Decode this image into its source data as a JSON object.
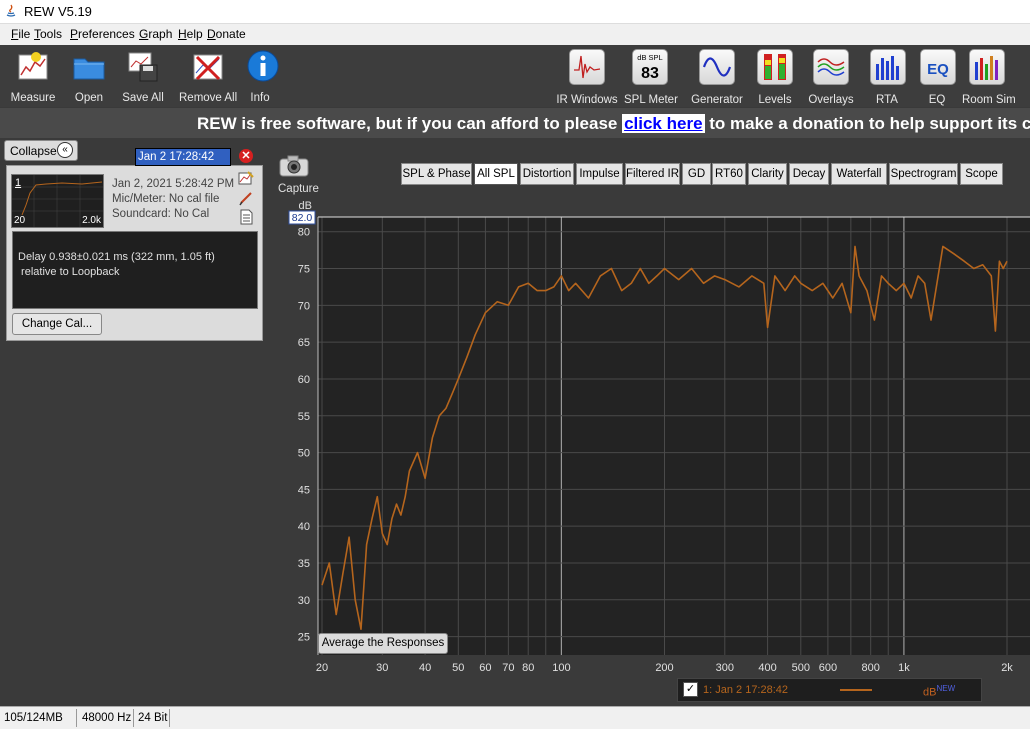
{
  "window": {
    "title": "REW V5.19"
  },
  "menu": [
    "File",
    "Tools",
    "Preferences",
    "Graph",
    "Help",
    "Donate"
  ],
  "toolbar_left": [
    {
      "label": "Measure",
      "icon": "measure-icon"
    },
    {
      "label": "Open",
      "icon": "folder-icon"
    },
    {
      "label": "Save All",
      "icon": "save-all-icon"
    },
    {
      "label": "Remove All",
      "icon": "remove-all-icon"
    },
    {
      "label": "Info",
      "icon": "info-icon"
    }
  ],
  "toolbar_right": [
    {
      "label": "IR Windows",
      "icon": "ir-windows-icon"
    },
    {
      "label": "SPL Meter",
      "icon": "spl-meter-icon",
      "display_top": "dB SPL",
      "display_value": "83"
    },
    {
      "label": "Generator",
      "icon": "generator-icon"
    },
    {
      "label": "Levels",
      "icon": "levels-icon"
    },
    {
      "label": "Overlays",
      "icon": "overlays-icon"
    },
    {
      "label": "RTA",
      "icon": "rta-icon"
    },
    {
      "label": "EQ",
      "icon": "eq-icon",
      "text": "EQ"
    },
    {
      "label": "Room Sim",
      "icon": "room-sim-icon"
    }
  ],
  "banner": {
    "pre": "REW is free software, but if you can afford to please ",
    "link": "click here",
    "post": " to make a donation to help support its continuin"
  },
  "measurement_panel": {
    "collapse_label": "Collapse",
    "name_field": "Jan 2 17:28:42",
    "thumb_index": "1",
    "thumb_xmin": "20",
    "thumb_xmax": "2.0k",
    "date": "Jan 2, 2021 5:28:42 PM",
    "mic": "Mic/Meter: No cal file",
    "soundcard": "Soundcard: No Cal",
    "delay_line1": "Delay 0.938±0.021 ms (322 mm, 1.05 ft)",
    "delay_line2": " relative to Loopback",
    "change_cal": "Change Cal..."
  },
  "capture_label": "Capture",
  "tabs": [
    "SPL & Phase",
    "All SPL",
    "Distortion",
    "Impulse",
    "Filtered IR",
    "GD",
    "RT60",
    "Clarity",
    "Decay",
    "Waterfall",
    "Spectrogram",
    "Scope"
  ],
  "selected_tab": "All SPL",
  "average_button": "Average the Responses",
  "legend": {
    "checked": true,
    "label": "1: Jan 2 17:28:42",
    "unit": "dB",
    "unit_sup": "NEW",
    "color": "#b5651d"
  },
  "status": {
    "memory": "105/124MB",
    "rate": "48000 Hz",
    "bits": "24 Bit"
  },
  "chart_data": {
    "type": "line",
    "ylabel": "dB",
    "ytop_readout": "82.0",
    "ylim": [
      22.5,
      82
    ],
    "xlim": [
      20,
      2000
    ],
    "xscale": "log",
    "y_ticks": [
      80,
      75,
      70,
      65,
      60,
      55,
      50,
      45,
      40,
      35,
      30,
      25
    ],
    "x_ticks": [
      {
        "v": 20,
        "l": "20"
      },
      {
        "v": 30,
        "l": "30"
      },
      {
        "v": 40,
        "l": "40"
      },
      {
        "v": 50,
        "l": "50"
      },
      {
        "v": 60,
        "l": "60"
      },
      {
        "v": 70,
        "l": "70"
      },
      {
        "v": 80,
        "l": "80"
      },
      {
        "v": 100,
        "l": "100"
      },
      {
        "v": 200,
        "l": "200"
      },
      {
        "v": 300,
        "l": "300"
      },
      {
        "v": 400,
        "l": "400"
      },
      {
        "v": 500,
        "l": "500"
      },
      {
        "v": 600,
        "l": "600"
      },
      {
        "v": 800,
        "l": "800"
      },
      {
        "v": 1000,
        "l": "1k"
      },
      {
        "v": 2000,
        "l": "2k"
      }
    ],
    "series": [
      {
        "color": "#b5651d",
        "x": [
          20,
          21,
          22,
          23,
          24,
          25,
          26,
          27,
          28,
          29,
          30,
          31,
          32,
          33,
          34,
          35,
          36,
          38,
          40,
          42,
          44,
          46,
          48,
          50,
          53,
          56,
          60,
          65,
          70,
          75,
          80,
          85,
          90,
          95,
          100,
          105,
          110,
          120,
          130,
          140,
          150,
          160,
          170,
          180,
          190,
          200,
          220,
          240,
          260,
          280,
          300,
          330,
          360,
          390,
          400,
          420,
          450,
          480,
          500,
          540,
          580,
          620,
          660,
          700,
          720,
          740,
          780,
          820,
          860,
          900,
          950,
          1000,
          1050,
          1100,
          1150,
          1200,
          1300,
          1400,
          1500,
          1600,
          1700,
          1800,
          1850,
          1900,
          1950,
          2000
        ],
        "y": [
          32,
          35,
          28,
          33.5,
          38.5,
          30,
          26,
          37.5,
          41,
          44,
          39,
          37.5,
          41,
          43,
          41.5,
          44,
          47.5,
          50,
          46.5,
          52,
          55,
          56,
          58,
          60,
          63,
          66,
          69,
          70.5,
          70,
          72.5,
          73,
          72,
          72,
          72.5,
          74,
          72,
          73,
          71,
          74,
          75,
          72,
          73,
          75,
          73,
          74,
          75,
          73.5,
          75,
          73,
          74,
          73.5,
          72.5,
          74,
          73,
          67,
          74,
          72,
          74,
          73,
          72,
          73,
          71,
          73,
          69,
          78,
          74,
          72,
          68,
          74,
          73,
          72,
          73,
          71,
          74,
          73,
          68,
          78,
          77,
          76,
          75,
          75.5,
          74,
          66.5,
          76,
          75,
          76
        ]
      }
    ]
  }
}
